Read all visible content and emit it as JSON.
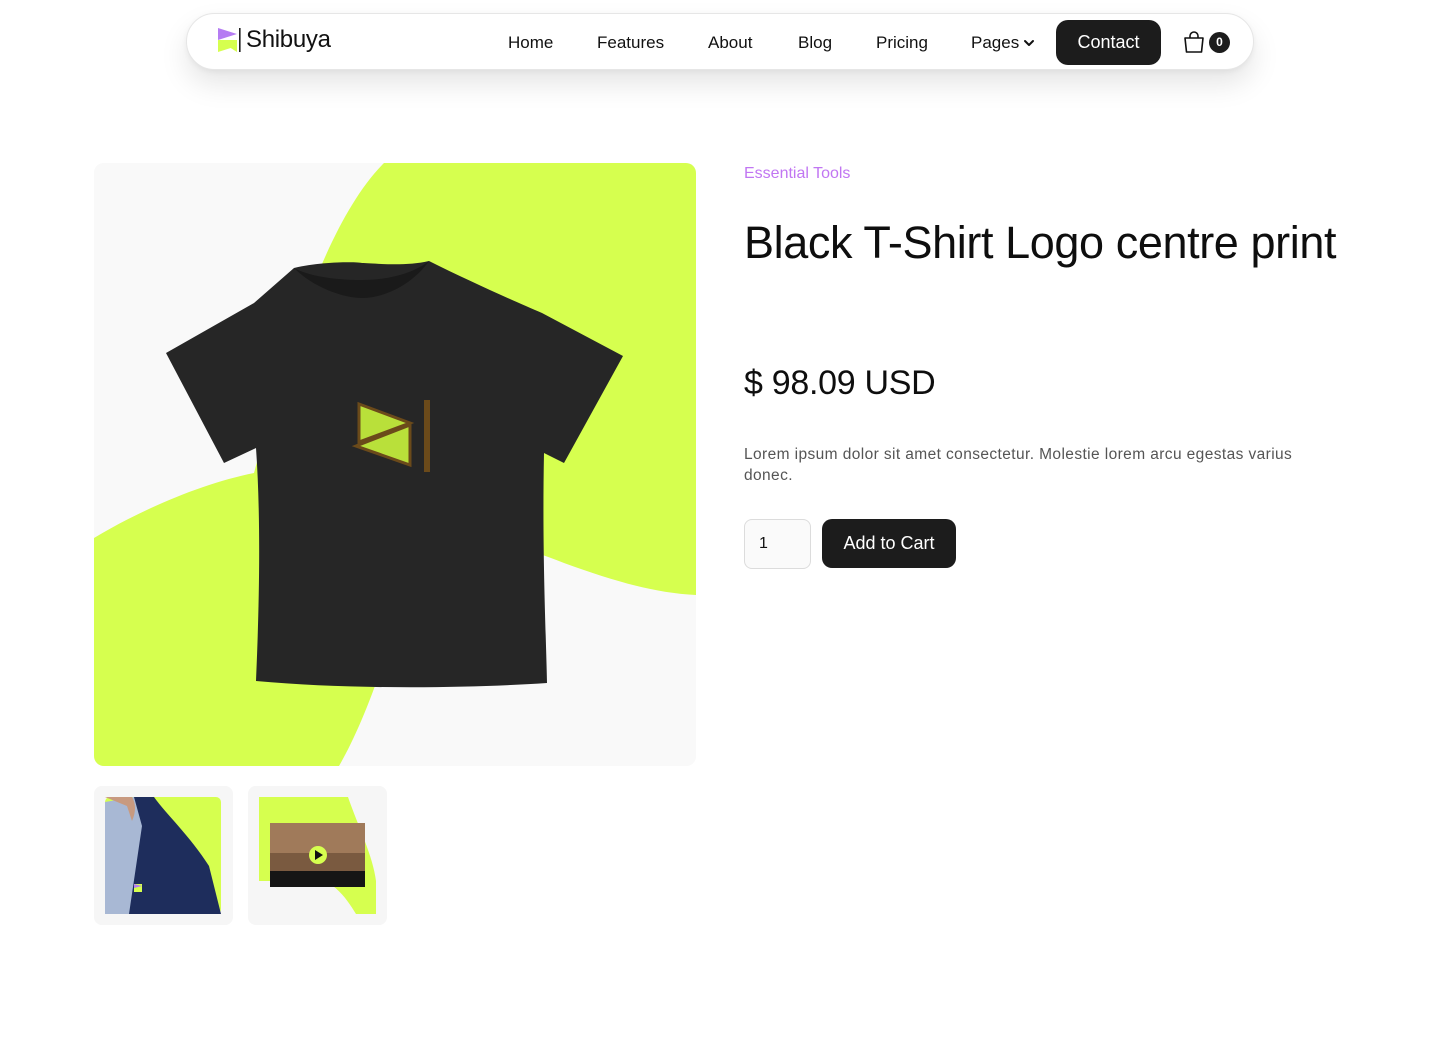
{
  "brand": {
    "name": "Shibuya"
  },
  "nav": {
    "links": [
      "Home",
      "Features",
      "About",
      "Blog",
      "Pricing",
      "Pages"
    ],
    "contact_label": "Contact",
    "cart_count": "0"
  },
  "product": {
    "category": "Essential Tools",
    "title": "Black T-Shirt Logo centre print",
    "price": "$ 98.09 USD",
    "description": "Lorem ipsum dolor sit amet consectetur. Molestie lorem arcu egestas varius donec.",
    "quantity": "1",
    "add_to_cart_label": "Add to Cart"
  },
  "colors": {
    "accent_lime": "#d6ff4f",
    "accent_purple": "#c176f2",
    "dark": "#1c1c1c"
  },
  "icons": {
    "logo": "shibuya-logo-icon",
    "chevron": "chevron-down-icon",
    "cart": "shopping-bag-icon",
    "play": "play-icon"
  }
}
